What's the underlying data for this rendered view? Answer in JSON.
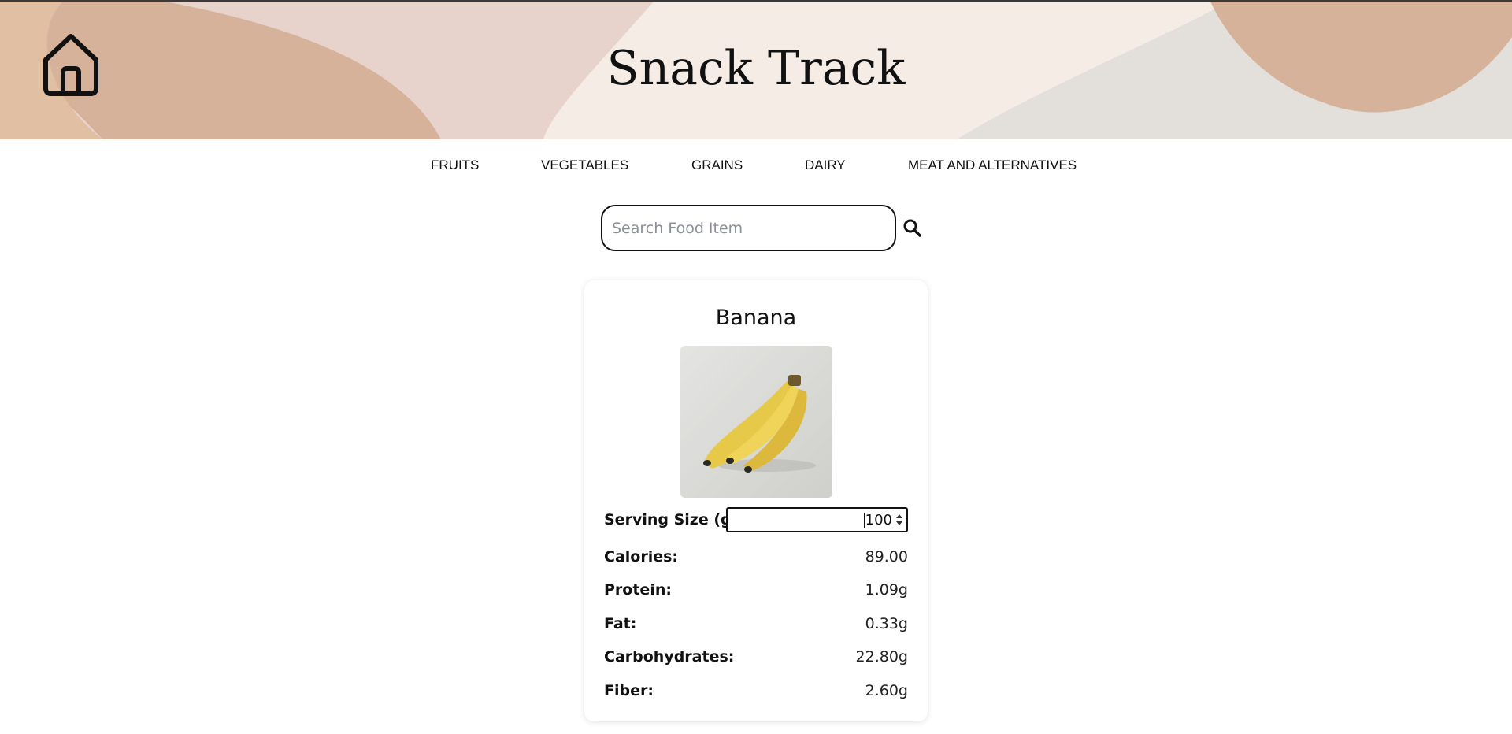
{
  "app": {
    "title": "Snack Track"
  },
  "nav": {
    "items": [
      {
        "label": "FRUITS"
      },
      {
        "label": "VEGETABLES"
      },
      {
        "label": "GRAINS"
      },
      {
        "label": "DAIRY"
      },
      {
        "label": "MEAT AND ALTERNATIVES"
      }
    ]
  },
  "search": {
    "placeholder": "Search Food Item",
    "value": ""
  },
  "food": {
    "name": "Banana",
    "serving_label": "Serving Size (g):",
    "serving_value": "100",
    "nutrients": [
      {
        "label": "Calories:",
        "value": "89.00"
      },
      {
        "label": "Protein:",
        "value": "1.09g"
      },
      {
        "label": "Fat:",
        "value": "0.33g"
      },
      {
        "label": "Carbohydrates:",
        "value": "22.80g"
      },
      {
        "label": "Fiber:",
        "value": "2.60g"
      }
    ]
  },
  "icons": {
    "home": "home-icon",
    "search": "search-icon",
    "spinner": "spinner-arrows-icon"
  },
  "colors": {
    "header_base": "#f4ece5",
    "blob_tan": "#d6b29a",
    "blob_pink": "#e8d3cc",
    "blob_gray": "#e3dfdb"
  }
}
